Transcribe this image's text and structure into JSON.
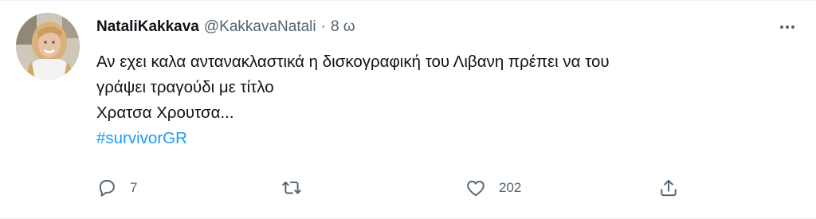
{
  "tweet": {
    "display_name": "NataliKakkava",
    "handle": "@KakkavaNatali",
    "separator": "·",
    "time": "8 ω",
    "avatar_icon": "user-avatar-photo",
    "more_icon": "more-horizontal-icon",
    "text_lines": [
      "Αν εχει καλα αντανακλαστικά η δισκογραφική του Λιβανη πρέπει να του",
      "γράψει τραγούδι με τίτλο",
      "Χρατσα Χρουτσα..."
    ],
    "hashtag": "#survivorGR",
    "colors": {
      "accent": "#1d9bf0",
      "text": "#0f1419",
      "secondary": "#536471"
    }
  },
  "actions": {
    "reply": {
      "icon": "reply-icon",
      "count": "7"
    },
    "retweet": {
      "icon": "retweet-icon",
      "count": ""
    },
    "like": {
      "icon": "heart-icon",
      "count": "202"
    },
    "share": {
      "icon": "share-icon",
      "count": ""
    }
  }
}
